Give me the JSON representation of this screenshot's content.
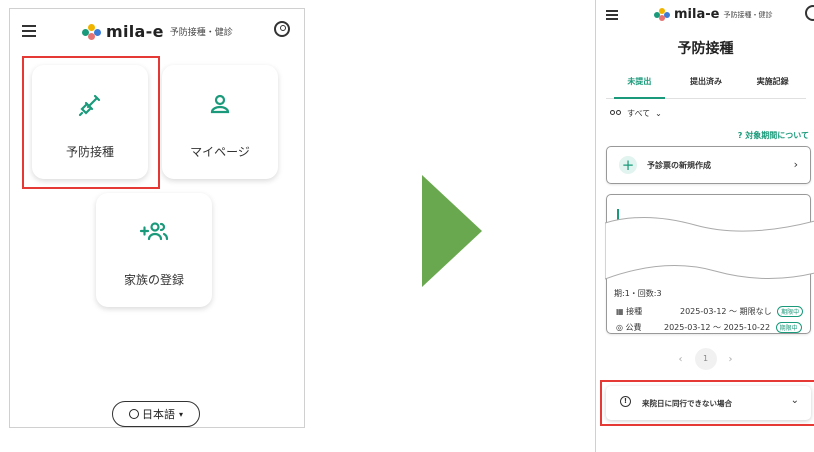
{
  "left": {
    "logo": {
      "name": "mila-e",
      "subtitle": "予防接種・健診"
    },
    "tiles": [
      {
        "label": "予防接種",
        "icon": "syringe-icon"
      },
      {
        "label": "マイページ",
        "icon": "person-icon"
      },
      {
        "label": "家族の登録",
        "icon": "add-family-icon"
      }
    ],
    "language": "日本語"
  },
  "right": {
    "logo": {
      "name": "mila-e",
      "subtitle": "予防接種・健診"
    },
    "title": "予防接種",
    "tabs": [
      "未提出",
      "提出済み",
      "実施記録"
    ],
    "filter": "すべて",
    "period_link": "対象期間について",
    "new_card": "予診票の新規作成",
    "card": {
      "period_count": "期:1・回数:3",
      "rows": [
        {
          "label": "接種",
          "range": "2025-03-12 ～ 期限なし",
          "tag": "期限中"
        },
        {
          "label": "公費",
          "range": "2025-03-12 ～ 2025-10-22",
          "tag": "期限中"
        }
      ]
    },
    "pager": {
      "current": "1"
    },
    "accordion": "来院日に同行できない場合"
  },
  "colors": {
    "accent": "#1a9a7a",
    "highlight": "#e53935",
    "arrow": "#6aa84f"
  }
}
